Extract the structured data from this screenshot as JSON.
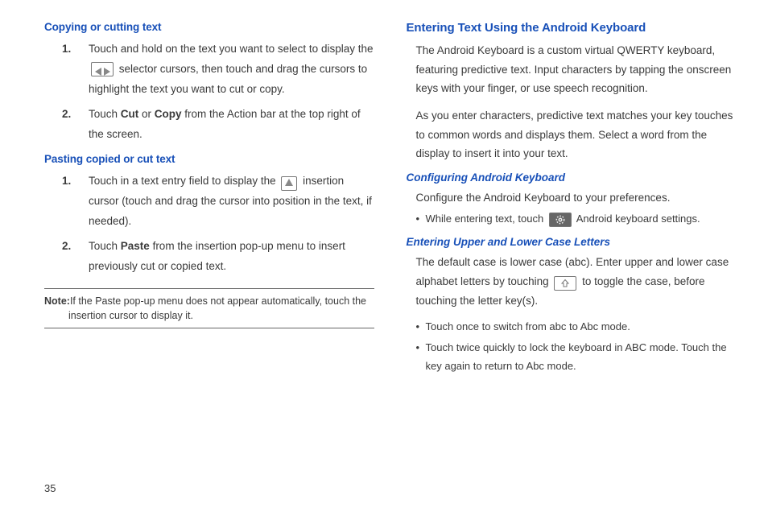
{
  "pageNumber": "35",
  "left": {
    "heading1": "Copying or cutting text",
    "list1": {
      "item1_a": "Touch and hold on the text you want to select to display the ",
      "item1_b": " selector cursors, then touch and drag the cursors to highlight the text you want to cut or copy.",
      "item2_a": "Touch ",
      "item2_cut": "Cut",
      "item2_or": " or ",
      "item2_copy": "Copy",
      "item2_b": " from the Action bar at the top right of the screen."
    },
    "heading2": "Pasting copied or cut text",
    "list2": {
      "item1_a": "Touch in a text entry field to display the ",
      "item1_b": " insertion cursor (touch and drag the cursor into position in the text, if needed).",
      "item2_a": "Touch ",
      "item2_paste": "Paste",
      "item2_b": " from the insertion pop-up menu to insert previously cut or copied text."
    },
    "note_label": "Note:",
    "note_text": "If the Paste pop-up menu does not appear automatically, touch the insertion cursor to display it."
  },
  "right": {
    "heading1": "Entering Text Using the Android Keyboard",
    "para1": "The Android Keyboard is a custom virtual QWERTY keyboard, featuring predictive text. Input characters by tapping the onscreen keys with your finger, or use speech recognition.",
    "para2": "As you enter characters, predictive text matches your key touches to common words and displays them. Select a word from the display to insert it into your text.",
    "heading2": "Configuring Android Keyboard",
    "para3": "Configure the Android Keyboard to your preferences.",
    "bullet1_a": "While entering text, touch ",
    "bullet1_b": " Android keyboard settings.",
    "heading3": "Entering Upper and Lower Case Letters",
    "para4_a": "The default case is lower case (abc). Enter upper and lower case alphabet letters by touching ",
    "para4_b": " to toggle the case, before touching the letter key(s).",
    "bullet2": "Touch once to switch from abc to Abc mode.",
    "bullet3": "Touch twice quickly to lock the keyboard in ABC mode. Touch the key again to return to Abc mode."
  }
}
